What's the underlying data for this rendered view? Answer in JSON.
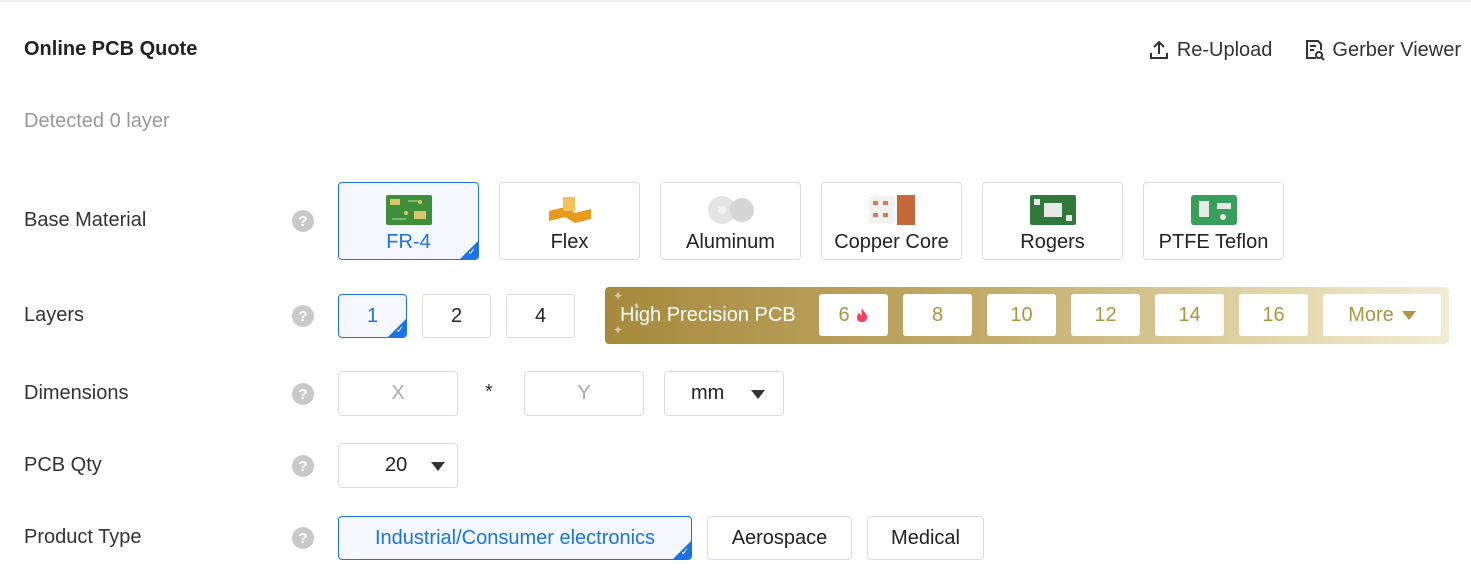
{
  "header": {
    "title": "Online PCB Quote",
    "reupload_label": "Re-Upload",
    "gerber_viewer_label": "Gerber Viewer"
  },
  "detected_text": "Detected 0 layer",
  "base_material": {
    "label": "Base Material",
    "options": [
      "FR-4",
      "Flex",
      "Aluminum",
      "Copper Core",
      "Rogers",
      "PTFE Teflon"
    ],
    "selected": "FR-4"
  },
  "layers": {
    "label": "Layers",
    "options": [
      "1",
      "2",
      "4"
    ],
    "selected": "1",
    "high_precision_label": "High Precision PCB",
    "high_precision_options": [
      "6",
      "8",
      "10",
      "12",
      "14",
      "16"
    ],
    "more_label": "More"
  },
  "dimensions": {
    "label": "Dimensions",
    "x_placeholder": "X",
    "y_placeholder": "Y",
    "separator": "*",
    "unit": "mm"
  },
  "pcb_qty": {
    "label": "PCB Qty",
    "value": "20"
  },
  "product_type": {
    "label": "Product Type",
    "options": [
      "Industrial/Consumer electronics",
      "Aerospace",
      "Medical"
    ],
    "selected": "Industrial/Consumer electronics"
  },
  "help_glyph": "?",
  "icons": {
    "upload": "upload-icon",
    "gerber": "document-search-icon",
    "help": "question-circle-icon",
    "hot": "flame-icon",
    "caret": "caret-down-icon"
  },
  "colors": {
    "accent": "#1a73e8",
    "gold": "#b0953e",
    "hot": "#ff3b5c"
  }
}
